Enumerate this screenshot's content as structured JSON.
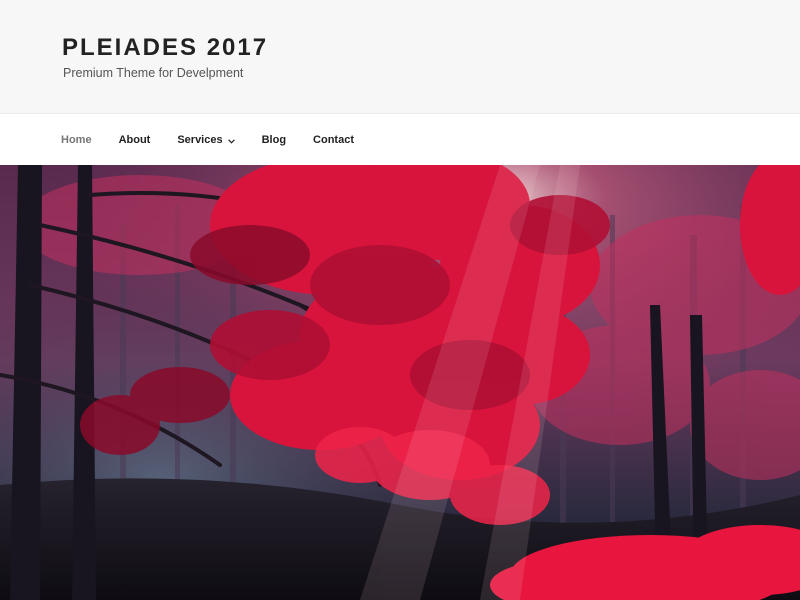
{
  "site": {
    "title": "PLEIADES 2017",
    "tagline": "Premium Theme for Develpment"
  },
  "nav": {
    "items": [
      {
        "label": "Home",
        "active": true
      },
      {
        "label": "About",
        "active": false
      },
      {
        "label": "Services",
        "active": false,
        "has_submenu": true
      },
      {
        "label": "Blog",
        "active": false
      },
      {
        "label": "Contact",
        "active": false
      }
    ]
  },
  "hero": {
    "image_subject": "red autumn forest"
  },
  "colors": {
    "header_bg": "#f7f7f7",
    "text": "#222222",
    "nav_active": "#767676",
    "leaf_red": "#d8143c",
    "forest_dark": "#1c1a2e"
  }
}
